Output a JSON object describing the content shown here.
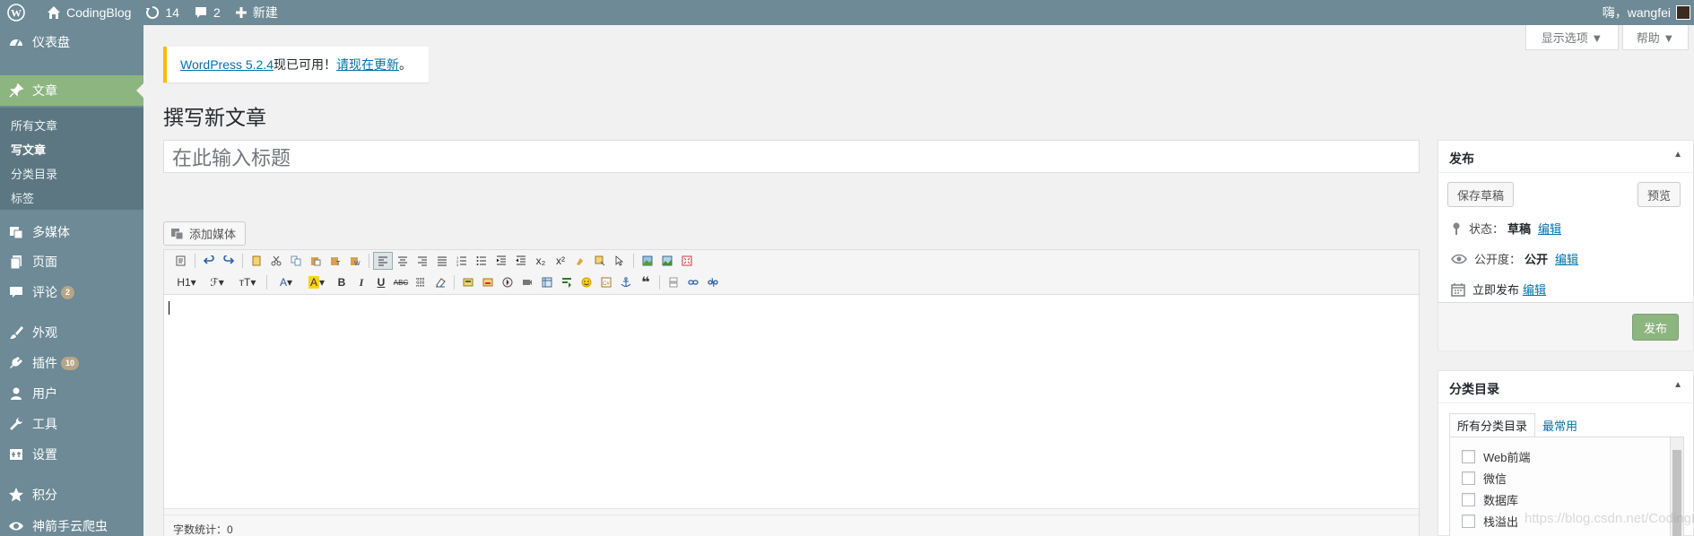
{
  "admin_bar": {
    "site_name": "CodingBlog",
    "updates_count": "14",
    "comments_count": "2",
    "new_label": "新建",
    "greeting": "嗨，wangfei"
  },
  "screen_meta": {
    "screen_options": "显示选项 ▼",
    "help": "帮助 ▼"
  },
  "menu": {
    "dashboard": "仪表盘",
    "posts": "文章",
    "posts_sub": [
      "所有文章",
      "写文章",
      "分类目录",
      "标签"
    ],
    "media": "多媒体",
    "pages": "页面",
    "comments": "评论",
    "comments_badge": "2",
    "appearance": "外观",
    "plugins": "插件",
    "plugins_badge": "10",
    "users": "用户",
    "tools": "工具",
    "settings": "设置",
    "points": "积分",
    "crawler": "神箭手云爬虫"
  },
  "notice": {
    "version_link": "WordPress 5.2.4",
    "middle_text": "现已可用！",
    "update_link": "请现在更新",
    "end": "。"
  },
  "page_title": "撰写新文章",
  "title_placeholder": "在此输入标题",
  "add_media": "添加媒体",
  "editor": {
    "row2_labels": [
      "H1",
      "ℱ",
      "тT",
      "A",
      "A",
      "B",
      "I",
      "U",
      "ABC"
    ],
    "word_count": "字数统计：0"
  },
  "publish": {
    "heading": "发布",
    "save_draft": "保存草稿",
    "preview": "预览",
    "status_label": "状态：",
    "status_value": "草稿",
    "visibility_label": "公开度：",
    "visibility_value": "公开",
    "schedule_prefix": "立即",
    "schedule_label": "发布",
    "edit_link": "编辑",
    "publish_button": "发布"
  },
  "categories": {
    "heading": "分类目录",
    "tab_all": "所有分类目录",
    "tab_popular": "最常用",
    "items": [
      "Web前端",
      "微信",
      "数据库",
      "栈溢出"
    ]
  },
  "watermark": "https://blog.csdn.net/CodingBlog",
  "colors": {
    "admin_bar": "#6d8a96",
    "menu_active": "#8db580",
    "notice_border": "#ffb900",
    "link": "#0073aa"
  }
}
